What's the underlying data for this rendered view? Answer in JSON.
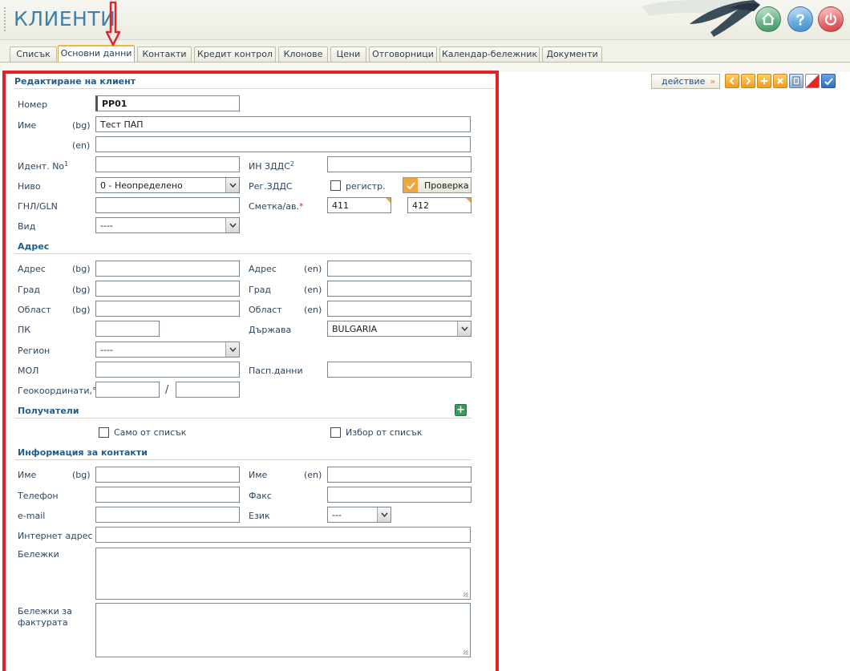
{
  "header": {
    "title": "КЛИЕНТИ",
    "buttons": [
      "home-icon",
      "help-icon",
      "power-icon"
    ]
  },
  "tabs": [
    {
      "label": "Списък",
      "active": false
    },
    {
      "label": "Основни данни",
      "active": true
    },
    {
      "label": "Контакти",
      "active": false
    },
    {
      "label": "Кредит контрол",
      "active": false
    },
    {
      "label": "Клонове",
      "active": false
    },
    {
      "label": "Цени",
      "active": false
    },
    {
      "label": "Отговорници",
      "active": false
    },
    {
      "label": "Календар-бележник",
      "active": false
    },
    {
      "label": "Документи",
      "active": false
    }
  ],
  "toolbar": {
    "action_label": "действие",
    "action_arrow": "»",
    "icons": [
      "prev-icon",
      "next-icon",
      "add-icon",
      "delete-icon",
      "print-icon",
      "color-icon",
      "confirm-icon"
    ]
  },
  "form": {
    "title": "Редактиране на клиент",
    "number": {
      "label": "Номер",
      "value": "PP01"
    },
    "name": {
      "label": "Име",
      "lang_bg": "(bg)",
      "lang_en": "(en)",
      "value_bg": "Тест ПАП",
      "value_en": ""
    },
    "ident": {
      "label": "Идент. No",
      "sup": "1",
      "value": ""
    },
    "vat_id": {
      "label": "ИН ЗДДС",
      "sup": "2",
      "value": ""
    },
    "level": {
      "label": "Ниво",
      "value": "0 - Неопределено"
    },
    "vat_reg": {
      "label": "Рег.ЗДДС",
      "checkbox_label": "регистр.",
      "checked": false,
      "check_button": "Проверка"
    },
    "gln": {
      "label": "ГНЛ/GLN",
      "value": ""
    },
    "account": {
      "label": "Сметка/ав.",
      "required_mark": "*",
      "value1": "411",
      "value2": "412"
    },
    "kind": {
      "label": "Вид",
      "value": "----"
    }
  },
  "address": {
    "title": "Адрес",
    "address_bg": {
      "label": "Адрес",
      "lang": "(bg)",
      "value": ""
    },
    "address_en": {
      "label": "Адрес",
      "lang": "(en)",
      "value": ""
    },
    "city_bg": {
      "label": "Град",
      "lang": "(bg)",
      "value": ""
    },
    "city_en": {
      "label": "Град",
      "lang": "(en)",
      "value": ""
    },
    "region_bg": {
      "label": "Област",
      "lang": "(bg)",
      "value": ""
    },
    "region_en": {
      "label": "Област",
      "lang": "(en)",
      "value": ""
    },
    "postcode": {
      "label": "ПК",
      "value": ""
    },
    "country": {
      "label": "Държава",
      "value": "BULGARIA"
    },
    "district": {
      "label": "Регион",
      "value": "----"
    },
    "mol": {
      "label": "МОЛ",
      "value": ""
    },
    "passport": {
      "label": "Пасп.данни",
      "value": ""
    },
    "geo": {
      "label": "Геокоординати,°",
      "separator": "/",
      "lat": "",
      "lon": ""
    }
  },
  "recipients": {
    "title": "Получатели",
    "only_from_list": "Само от списък",
    "choose_from_list": "Избор от списък"
  },
  "contact": {
    "title": "Информация за контакти",
    "name_bg": {
      "label": "Име",
      "lang": "(bg)",
      "value": ""
    },
    "name_en": {
      "label": "Име",
      "lang": "(en)",
      "value": ""
    },
    "phone": {
      "label": "Телефон",
      "value": ""
    },
    "fax": {
      "label": "Факс",
      "value": ""
    },
    "email": {
      "label": "e-mail",
      "value": ""
    },
    "language": {
      "label": "Език",
      "value": "---"
    },
    "website": {
      "label": "Интернет адрес",
      "value": ""
    },
    "notes": {
      "label": "Бележки",
      "value": ""
    },
    "invoice_notes": {
      "label_line1": "Бележки за",
      "label_line2": "фактурата",
      "value": ""
    }
  },
  "colors": {
    "accent": "#3f7fa8",
    "annotation": "#e2222a",
    "tab_active": "#e8b84a"
  }
}
